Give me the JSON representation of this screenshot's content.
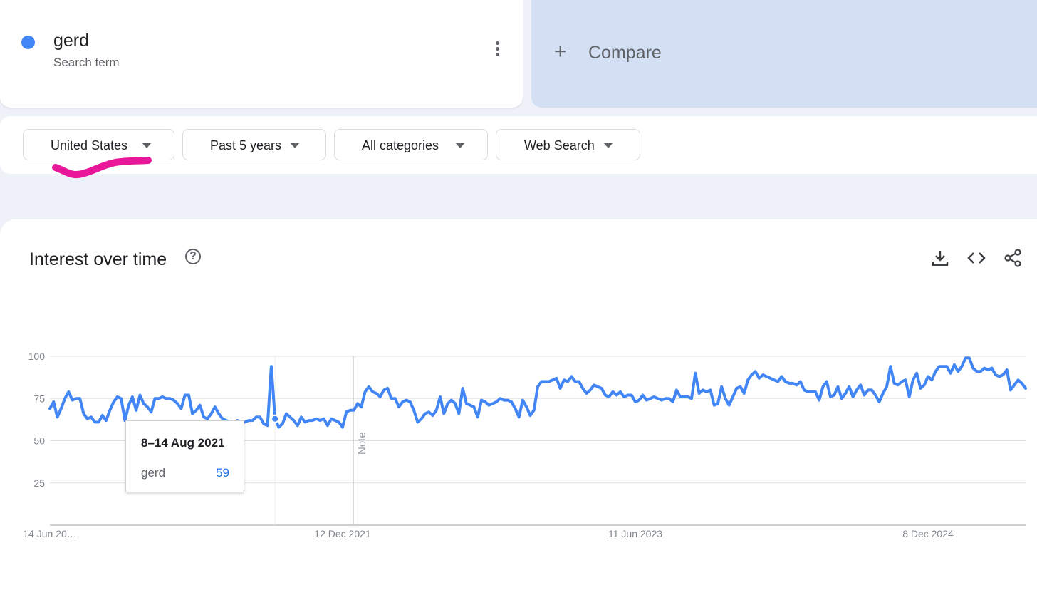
{
  "search_term": {
    "name": "gerd",
    "subtitle": "Search term",
    "color": "#4285f4"
  },
  "compare": {
    "label": "Compare"
  },
  "filters": [
    {
      "label": "United States"
    },
    {
      "label": "Past 5 years"
    },
    {
      "label": "All categories"
    },
    {
      "label": "Web Search"
    }
  ],
  "panel": {
    "title": "Interest over time",
    "tools": [
      "download-icon",
      "embed-code-icon",
      "share-icon"
    ]
  },
  "tooltip": {
    "date": "8–14 Aug 2021",
    "term": "gerd",
    "value": "59"
  },
  "chart_data": {
    "type": "line",
    "x_start": "2020-06-14",
    "x_step_days": 7,
    "x_tick_labels": [
      "14 Jun 20…",
      "12 Dec 2021",
      "11 Jun 2023",
      "8 Dec 2024"
    ],
    "y_ticks": [
      25,
      50,
      75,
      100
    ],
    "ylim": [
      0,
      100
    ],
    "grid": true,
    "note_label": "Note",
    "note_date": "2022-01-01",
    "highlight_date": "2021-08-08",
    "series": [
      {
        "name": "gerd",
        "color": "#4285f4",
        "values": [
          69,
          73,
          64,
          69,
          75,
          79,
          74,
          75,
          75,
          66,
          63,
          64,
          61,
          61,
          65,
          62,
          68,
          73,
          76,
          75,
          62,
          71,
          76,
          68,
          77,
          72,
          70,
          67,
          75,
          75,
          76,
          75,
          75,
          74,
          72,
          69,
          77,
          77,
          66,
          68,
          71,
          64,
          63,
          66,
          70,
          66,
          63,
          62,
          61,
          61,
          62,
          61,
          61,
          62,
          62,
          64,
          64,
          60,
          59,
          94,
          63,
          58,
          60,
          66,
          64,
          62,
          59,
          64,
          61,
          62,
          62,
          63,
          62,
          63,
          59,
          63,
          62,
          61,
          58,
          67,
          68,
          68,
          72,
          70,
          79,
          82,
          79,
          78,
          76,
          80,
          81,
          75,
          75,
          70,
          73,
          74,
          73,
          68,
          61,
          63,
          66,
          67,
          65,
          68,
          76,
          66,
          72,
          74,
          72,
          66,
          81,
          72,
          71,
          70,
          64,
          74,
          73,
          71,
          72,
          73,
          75,
          74,
          74,
          73,
          69,
          64,
          74,
          70,
          65,
          68,
          82,
          85,
          85,
          85,
          86,
          87,
          81,
          86,
          85,
          88,
          85,
          85,
          81,
          78,
          80,
          83,
          82,
          81,
          77,
          76,
          79,
          77,
          79,
          76,
          77,
          77,
          73,
          74,
          77,
          74,
          75,
          76,
          75,
          74,
          75,
          75,
          73,
          80,
          76,
          76,
          76,
          75,
          90,
          78,
          80,
          79,
          80,
          71,
          72,
          82,
          75,
          71,
          76,
          81,
          82,
          78,
          86,
          89,
          91,
          87,
          89,
          88,
          87,
          86,
          85,
          88,
          85,
          84,
          84,
          83,
          85,
          80,
          79,
          79,
          79,
          74,
          82,
          85,
          76,
          77,
          82,
          75,
          78,
          82,
          76,
          80,
          83,
          77,
          80,
          80,
          77,
          73,
          78,
          82,
          94,
          84,
          83,
          85,
          86,
          76,
          86,
          90,
          81,
          83,
          88,
          86,
          91,
          94,
          94,
          94,
          90,
          95,
          91,
          94,
          99,
          99,
          93,
          91,
          91,
          93,
          92,
          93,
          89,
          88,
          89,
          92,
          80,
          83,
          86,
          84,
          81
        ]
      }
    ]
  }
}
